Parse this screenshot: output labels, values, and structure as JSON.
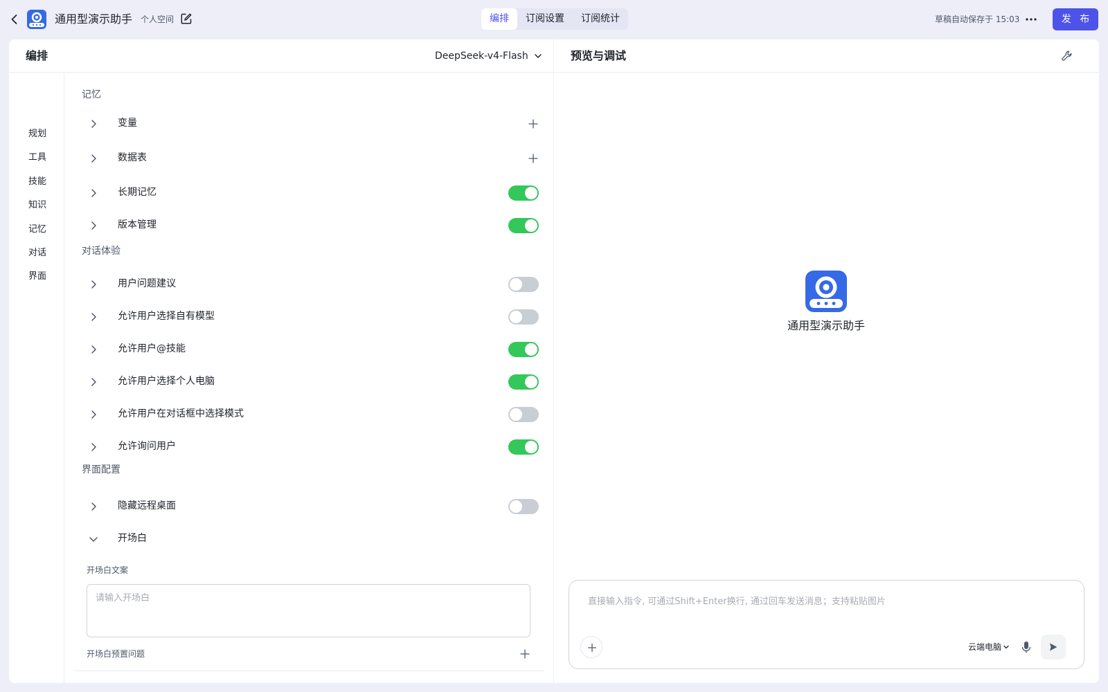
{
  "topbar": {
    "app_title": "通用型演示助手",
    "space_tag": "个人空间",
    "tabs": [
      {
        "label": "编排",
        "active": true
      },
      {
        "label": "订阅设置",
        "active": false
      },
      {
        "label": "订阅统计",
        "active": false
      }
    ],
    "save_status": "草稿自动保存于 15:03",
    "publish_label": "发 布"
  },
  "editor": {
    "title": "编排",
    "model": "DeepSeek-v4-Flash",
    "nav": [
      "规划",
      "工具",
      "技能",
      "知识",
      "记忆",
      "对话",
      "界面"
    ],
    "memory": {
      "title": "记忆",
      "rows": [
        {
          "label": "变量",
          "control": "add"
        },
        {
          "label": "数据表",
          "control": "add"
        },
        {
          "label": "长期记忆",
          "control": "toggle",
          "on": true
        },
        {
          "label": "版本管理",
          "control": "toggle",
          "on": true
        }
      ]
    },
    "dialogue": {
      "title": "对话体验",
      "rows": [
        {
          "label": "用户问题建议",
          "on": false
        },
        {
          "label": "允许用户选择自有模型",
          "on": false
        },
        {
          "label": "允许用户@技能",
          "on": true
        },
        {
          "label": "允许用户选择个人电脑",
          "on": true
        },
        {
          "label": "允许用户在对话框中选择模式",
          "on": false
        },
        {
          "label": "允许询问用户",
          "on": true
        }
      ]
    },
    "interface": {
      "title": "界面配置",
      "rows": [
        {
          "label": "隐藏远程桌面",
          "on": false
        },
        {
          "label": "开场白",
          "expanded": true
        }
      ],
      "opening_text_label": "开场白文案",
      "opening_text_placeholder": "请输入开场白",
      "opening_text_value": "",
      "preset_questions_label": "开场白预置问题"
    }
  },
  "preview": {
    "title": "预览与调试",
    "bot_name": "通用型演示助手",
    "input_placeholder": "直接输入指令, 可通过Shift+Enter换行, 通过回车发送消息；支持粘贴图片",
    "input_value": "",
    "computer_label": "云端电脑"
  },
  "colors": {
    "accent": "#4d53e8",
    "toggle_on": "#34c759",
    "toggle_off": "#c9cdd4",
    "page_bg": "#eeeef9",
    "logo_blue": "#3569e6"
  },
  "icons": [
    "back-arrow-icon",
    "bot-logo-icon",
    "edit-icon",
    "more-icon",
    "chevron-down-icon",
    "wrench-icon",
    "chevron-right-icon",
    "plus-icon",
    "mic-icon",
    "send-icon"
  ]
}
